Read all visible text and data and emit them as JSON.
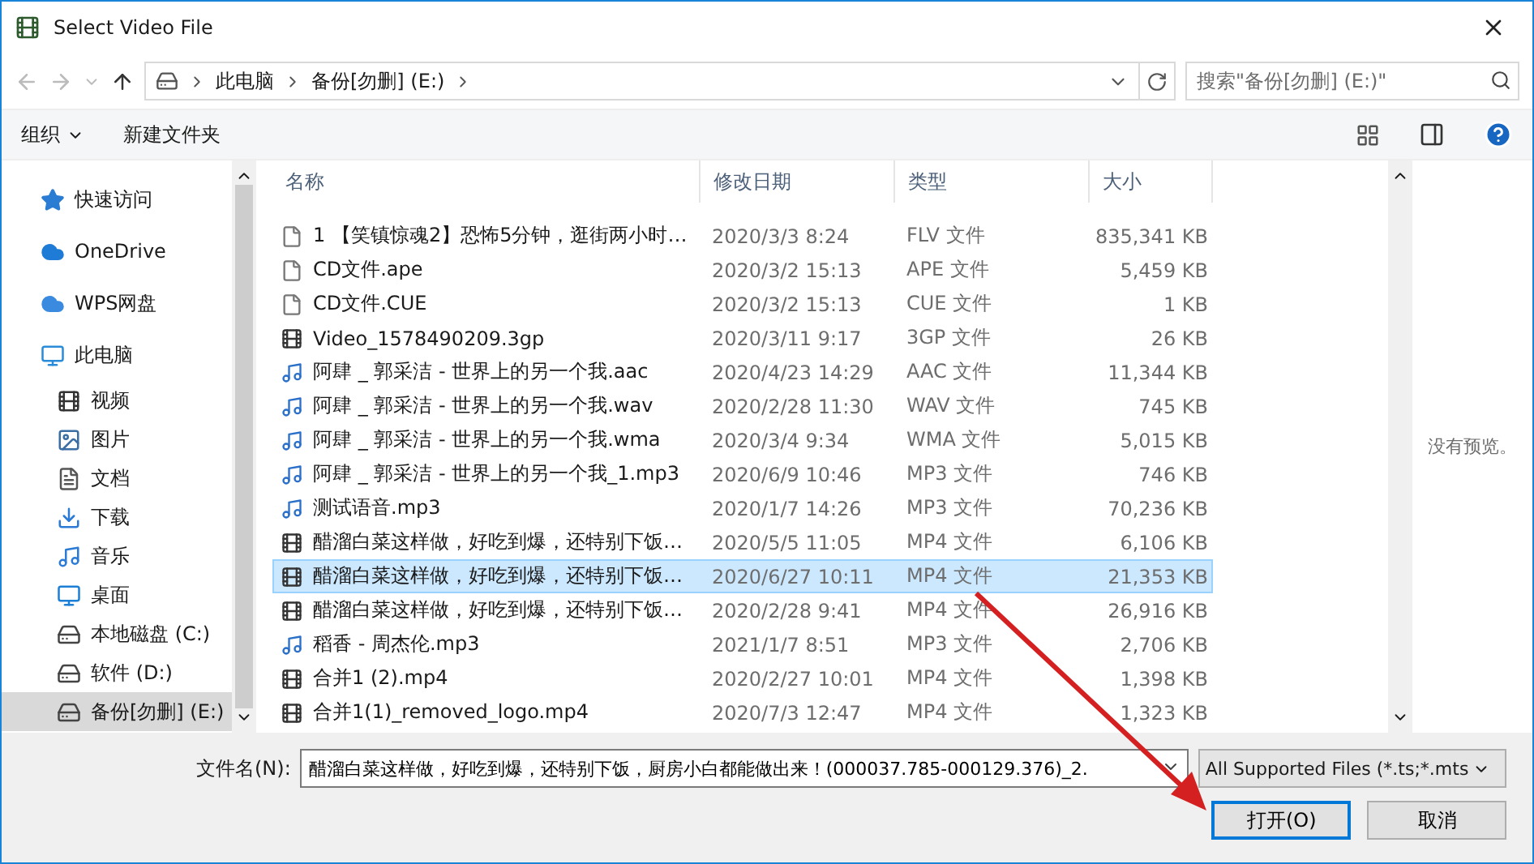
{
  "window": {
    "title": "Select Video File"
  },
  "address": {
    "crumbs": [
      "此电脑",
      "备份[勿删] (E:)"
    ]
  },
  "search": {
    "placeholder": "搜索\"备份[勿删] (E:)\""
  },
  "toolbar": {
    "organize": "组织",
    "new_folder": "新建文件夹"
  },
  "sidebar": {
    "items": [
      {
        "label": "快速访问",
        "kind": "star",
        "selected": false
      },
      {
        "label": "OneDrive",
        "kind": "cloud",
        "selected": false
      },
      {
        "label": "WPS网盘",
        "kind": "cloud2",
        "selected": false
      },
      {
        "label": "此电脑",
        "kind": "pc",
        "selected": false,
        "children": [
          {
            "label": "视频",
            "kind": "video",
            "selected": false
          },
          {
            "label": "图片",
            "kind": "picture",
            "selected": false
          },
          {
            "label": "文档",
            "kind": "doc",
            "selected": false
          },
          {
            "label": "下载",
            "kind": "download",
            "selected": false
          },
          {
            "label": "音乐",
            "kind": "music",
            "selected": false
          },
          {
            "label": "桌面",
            "kind": "desktop",
            "selected": false
          },
          {
            "label": "本地磁盘 (C:)",
            "kind": "sysdrive",
            "selected": false
          },
          {
            "label": "软件 (D:)",
            "kind": "drive",
            "selected": false
          },
          {
            "label": "备份[勿删] (E:)",
            "kind": "drive",
            "selected": true
          }
        ]
      }
    ]
  },
  "table": {
    "columns": [
      "名称",
      "修改日期",
      "类型",
      "大小"
    ],
    "rows": [
      {
        "name": "1 【笑镇惊魂2】恐怖5分钟，逛街两小时…",
        "date": "2020/3/3 8:24",
        "type": "FLV 文件",
        "size": "835,341 KB",
        "kind": "blank",
        "selected": false
      },
      {
        "name": "CD文件.ape",
        "date": "2020/3/2 15:13",
        "type": "APE 文件",
        "size": "5,459 KB",
        "kind": "blank",
        "selected": false
      },
      {
        "name": "CD文件.CUE",
        "date": "2020/3/2 15:13",
        "type": "CUE 文件",
        "size": "1 KB",
        "kind": "blank",
        "selected": false
      },
      {
        "name": "Video_1578490209.3gp",
        "date": "2020/3/11 9:17",
        "type": "3GP 文件",
        "size": "26 KB",
        "kind": "video",
        "selected": false
      },
      {
        "name": "阿肆 _ 郭采洁 - 世界上的另一个我.aac",
        "date": "2020/4/23 14:29",
        "type": "AAC 文件",
        "size": "11,344 KB",
        "kind": "audio",
        "selected": false
      },
      {
        "name": "阿肆 _ 郭采洁 - 世界上的另一个我.wav",
        "date": "2020/2/28 11:30",
        "type": "WAV 文件",
        "size": "745 KB",
        "kind": "audio",
        "selected": false
      },
      {
        "name": "阿肆 _ 郭采洁 - 世界上的另一个我.wma",
        "date": "2020/3/4 9:34",
        "type": "WMA 文件",
        "size": "5,015 KB",
        "kind": "audio",
        "selected": false
      },
      {
        "name": "阿肆 _ 郭采洁 - 世界上的另一个我_1.mp3",
        "date": "2020/6/9 10:46",
        "type": "MP3 文件",
        "size": "746 KB",
        "kind": "audio",
        "selected": false
      },
      {
        "name": "测试语音.mp3",
        "date": "2020/1/7 14:26",
        "type": "MP3 文件",
        "size": "70,236 KB",
        "kind": "audio",
        "selected": false
      },
      {
        "name": "醋溜白菜这样做，好吃到爆，还特别下饭…",
        "date": "2020/5/5 11:05",
        "type": "MP4 文件",
        "size": "6,106 KB",
        "kind": "video",
        "selected": false
      },
      {
        "name": "醋溜白菜这样做，好吃到爆，还特别下饭…",
        "date": "2020/6/27 10:11",
        "type": "MP4 文件",
        "size": "21,353 KB",
        "kind": "video",
        "selected": true
      },
      {
        "name": "醋溜白菜这样做，好吃到爆，还特别下饭…",
        "date": "2020/2/28 9:41",
        "type": "MP4 文件",
        "size": "26,916 KB",
        "kind": "video",
        "selected": false
      },
      {
        "name": "稻香 - 周杰伦.mp3",
        "date": "2021/1/7 8:51",
        "type": "MP3 文件",
        "size": "2,706 KB",
        "kind": "audio",
        "selected": false
      },
      {
        "name": "合并1 (2).mp4",
        "date": "2020/2/27 10:01",
        "type": "MP4 文件",
        "size": "1,398 KB",
        "kind": "video",
        "selected": false
      },
      {
        "name": "合并1(1)_removed_logo.mp4",
        "date": "2020/7/3 12:47",
        "type": "MP4 文件",
        "size": "1,323 KB",
        "kind": "video",
        "selected": false
      }
    ]
  },
  "preview": {
    "message": "没有预览。"
  },
  "footer": {
    "filename_label": "文件名(N):",
    "filename": "醋溜白菜这样做，好吃到爆，还特别下饭，厨房小白都能做出来！(000037.785-000129.376)_2.",
    "filter": "All Supported Files (*.ts;*.mts",
    "open": "打开(O)",
    "cancel": "取消"
  }
}
